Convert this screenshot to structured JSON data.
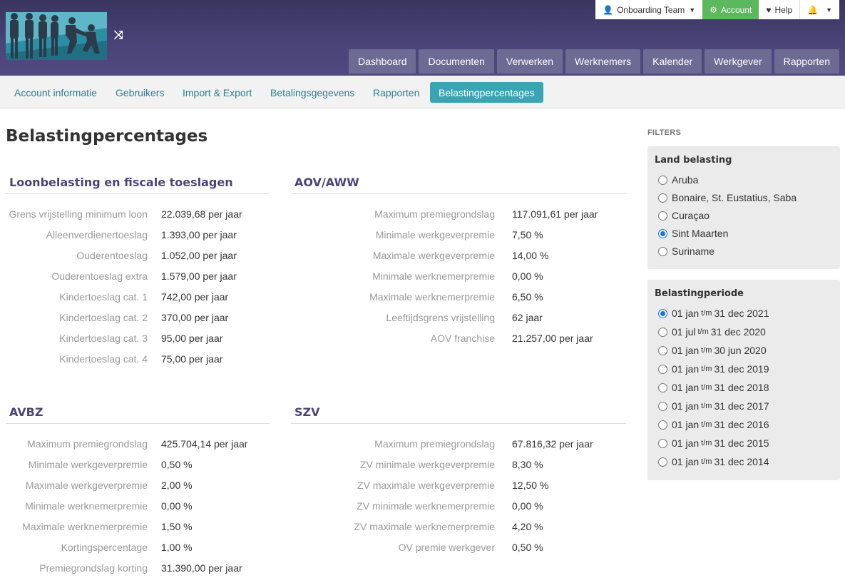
{
  "header": {
    "topbar": {
      "team_label": "Onboarding Team",
      "account_label": "Account",
      "help_label": "Help"
    },
    "nav": [
      "Dashboard",
      "Documenten",
      "Verwerken",
      "Werknemers",
      "Kalender",
      "Werkgever",
      "Rapporten"
    ]
  },
  "subnav": [
    "Account informatie",
    "Gebruikers",
    "Import & Export",
    "Betalingsgegevens",
    "Rapporten",
    "Belastingpercentages"
  ],
  "page_title": "Belastingpercentages",
  "sections": {
    "loonbelasting": {
      "title": "Loonbelasting en fiscale toeslagen",
      "rows": [
        {
          "label": "Grens vrijstelling minimum loon",
          "value": "22.039,68 per jaar"
        },
        {
          "label": "Alleenverdienertoeslag",
          "value": "1.393,00 per jaar"
        },
        {
          "label": "Ouderentoeslag",
          "value": "1.052,00 per jaar"
        },
        {
          "label": "Ouderentoeslag extra",
          "value": "1.579,00 per jaar"
        },
        {
          "label": "Kindertoeslag cat. 1",
          "value": "742,00 per jaar"
        },
        {
          "label": "Kindertoeslag cat. 2",
          "value": "370,00 per jaar"
        },
        {
          "label": "Kindertoeslag cat. 3",
          "value": "95,00 per jaar"
        },
        {
          "label": "Kindertoeslag cat. 4",
          "value": "75,00 per jaar"
        }
      ]
    },
    "aov": {
      "title": "AOV/AWW",
      "rows": [
        {
          "label": "Maximum premiegrondslag",
          "value": "117.091,61 per jaar"
        },
        {
          "label": "Minimale werkgeverpremie",
          "value": "7,50 %"
        },
        {
          "label": "Maximale werkgeverpremie",
          "value": "14,00 %"
        },
        {
          "label": "Minimale werknemerpremie",
          "value": "0,00 %"
        },
        {
          "label": "Maximale werknemerpremie",
          "value": "6,50 %"
        },
        {
          "label": "Leeftijdsgrens vrijstelling",
          "value": "62 jaar"
        },
        {
          "label": "AOV franchise",
          "value": "21.257,00 per jaar"
        }
      ]
    },
    "avbz": {
      "title": "AVBZ",
      "rows": [
        {
          "label": "Maximum premiegrondslag",
          "value": "425.704,14 per jaar"
        },
        {
          "label": "Minimale werkgeverpremie",
          "value": "0,50 %"
        },
        {
          "label": "Maximale werkgeverpremie",
          "value": "2,00 %"
        },
        {
          "label": "Minimale werknemerpremie",
          "value": "0,00 %"
        },
        {
          "label": "Maximale werknemerpremie",
          "value": "1,50 %"
        },
        {
          "label": "Kortingspercentage",
          "value": "1,00 %"
        },
        {
          "label": "Premiegrondslag korting",
          "value": "31.390,00 per jaar"
        }
      ]
    },
    "szv": {
      "title": "SZV",
      "rows": [
        {
          "label": "Maximum premiegrondslag",
          "value": "67.816,32 per jaar"
        },
        {
          "label": "ZV minimale werkgeverpremie",
          "value": "8,30 %"
        },
        {
          "label": "ZV maximale werkgeverpremie",
          "value": "12,50 %"
        },
        {
          "label": "ZV minimale werknemerpremie",
          "value": "0,00 %"
        },
        {
          "label": "ZV maximale werknemerpremie",
          "value": "4,20 %"
        },
        {
          "label": "OV premie werkgever",
          "value": "0,50 %"
        }
      ]
    }
  },
  "filters": {
    "title": "FILTERS",
    "land": {
      "title": "Land belasting",
      "options": [
        "Aruba",
        "Bonaire, St. Eustatius, Saba",
        "Curaçao",
        "Sint Maarten",
        "Suriname"
      ],
      "selected": "Sint Maarten"
    },
    "periode": {
      "title": "Belastingperiode",
      "options": [
        {
          "from": "01 jan",
          "tm": "t/m",
          "to": "31 dec 2021"
        },
        {
          "from": "01 jul",
          "tm": "t/m",
          "to": "31 dec 2020"
        },
        {
          "from": "01 jan",
          "tm": "t/m",
          "to": "30 jun 2020"
        },
        {
          "from": "01 jan",
          "tm": "t/m",
          "to": "31 dec 2019"
        },
        {
          "from": "01 jan",
          "tm": "t/m",
          "to": "31 dec 2018"
        },
        {
          "from": "01 jan",
          "tm": "t/m",
          "to": "31 dec 2017"
        },
        {
          "from": "01 jan",
          "tm": "t/m",
          "to": "31 dec 2016"
        },
        {
          "from": "01 jan",
          "tm": "t/m",
          "to": "31 dec 2015"
        },
        {
          "from": "01 jan",
          "tm": "t/m",
          "to": "31 dec 2014"
        }
      ],
      "selected_index": 0
    }
  },
  "colors": {
    "header_bg": "#4a4478",
    "nav_button": "#6d6a94",
    "active_tab": "#3aa3b4",
    "account_green": "#5cb85c",
    "section_title": "#4a4478"
  }
}
